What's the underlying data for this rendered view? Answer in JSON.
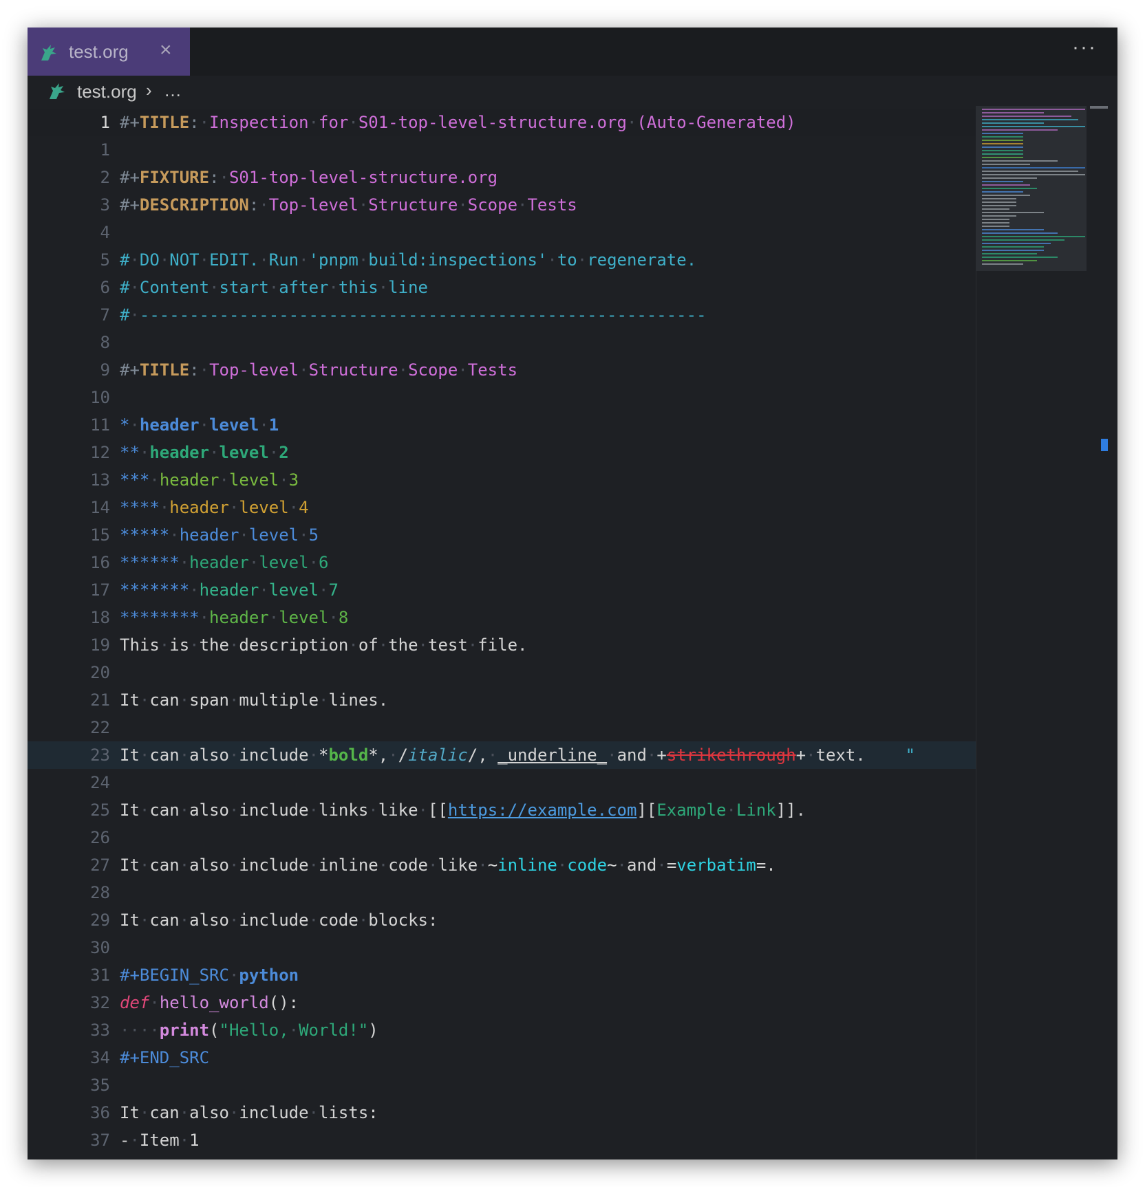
{
  "tab": {
    "label": "test.org",
    "close_glyph": "×",
    "icon": "unicorn-icon"
  },
  "more_glyph": "···",
  "breadcrumb": {
    "file": "test.org",
    "separator": "›",
    "more": "…"
  },
  "colors": {
    "tab_active": "#4b3c78",
    "editor_bg": "#1e2024"
  },
  "lines": [
    {
      "n": "1",
      "tokens": [
        [
          "c-meta",
          "#+"
        ],
        [
          "c-key",
          "TITLE"
        ],
        [
          "c-meta",
          ":"
        ],
        [
          "ws",
          "·"
        ],
        [
          "c-title",
          "Inspection"
        ],
        [
          "ws",
          "·"
        ],
        [
          "c-title",
          "for"
        ],
        [
          "ws",
          "·"
        ],
        [
          "c-title",
          "S01-top-level-structure.org"
        ],
        [
          "ws",
          "·"
        ],
        [
          "c-title",
          "(Auto-Generated)"
        ]
      ]
    },
    {
      "n": "1",
      "tokens": []
    },
    {
      "n": "2",
      "tokens": [
        [
          "c-meta",
          "#+"
        ],
        [
          "c-key",
          "FIXTURE"
        ],
        [
          "c-meta",
          ":"
        ],
        [
          "ws",
          "·"
        ],
        [
          "c-title",
          "S01-top-level-structure.org"
        ]
      ]
    },
    {
      "n": "3",
      "tokens": [
        [
          "c-meta",
          "#+"
        ],
        [
          "c-key",
          "DESCRIPTION"
        ],
        [
          "c-meta",
          ":"
        ],
        [
          "ws",
          "·"
        ],
        [
          "c-title",
          "Top-level"
        ],
        [
          "ws",
          "·"
        ],
        [
          "c-title",
          "Structure"
        ],
        [
          "ws",
          "·"
        ],
        [
          "c-title",
          "Scope"
        ],
        [
          "ws",
          "·"
        ],
        [
          "c-title",
          "Tests"
        ]
      ]
    },
    {
      "n": "4",
      "tokens": []
    },
    {
      "n": "5",
      "tokens": [
        [
          "c-comment",
          "#"
        ],
        [
          "ws",
          "·"
        ],
        [
          "c-comment",
          "DO"
        ],
        [
          "ws",
          "·"
        ],
        [
          "c-comment",
          "NOT"
        ],
        [
          "ws",
          "·"
        ],
        [
          "c-comment",
          "EDIT."
        ],
        [
          "ws",
          "·"
        ],
        [
          "c-comment",
          "Run"
        ],
        [
          "ws",
          "·"
        ],
        [
          "c-comment",
          "'pnpm"
        ],
        [
          "ws",
          "·"
        ],
        [
          "c-comment",
          "build:inspections'"
        ],
        [
          "ws",
          "·"
        ],
        [
          "c-comment",
          "to"
        ],
        [
          "ws",
          "·"
        ],
        [
          "c-comment",
          "regenerate."
        ]
      ]
    },
    {
      "n": "6",
      "tokens": [
        [
          "c-comment",
          "#"
        ],
        [
          "ws",
          "·"
        ],
        [
          "c-comment",
          "Content"
        ],
        [
          "ws",
          "·"
        ],
        [
          "c-comment",
          "start"
        ],
        [
          "ws",
          "·"
        ],
        [
          "c-comment",
          "after"
        ],
        [
          "ws",
          "·"
        ],
        [
          "c-comment",
          "this"
        ],
        [
          "ws",
          "·"
        ],
        [
          "c-comment",
          "line"
        ]
      ]
    },
    {
      "n": "7",
      "tokens": [
        [
          "c-comment",
          "#"
        ],
        [
          "ws",
          "·"
        ],
        [
          "c-comment",
          "---------------------------------------------------------"
        ]
      ]
    },
    {
      "n": "8",
      "tokens": []
    },
    {
      "n": "9",
      "tokens": [
        [
          "c-meta",
          "#+"
        ],
        [
          "c-key",
          "TITLE"
        ],
        [
          "c-meta",
          ":"
        ],
        [
          "ws",
          "·"
        ],
        [
          "c-title",
          "Top-level"
        ],
        [
          "ws",
          "·"
        ],
        [
          "c-title",
          "Structure"
        ],
        [
          "ws",
          "·"
        ],
        [
          "c-title",
          "Scope"
        ],
        [
          "ws",
          "·"
        ],
        [
          "c-title",
          "Tests"
        ]
      ]
    },
    {
      "n": "10",
      "tokens": []
    },
    {
      "n": "11",
      "tokens": [
        [
          "c-star",
          "*"
        ],
        [
          "ws",
          "·"
        ],
        [
          "c-h1",
          "header"
        ],
        [
          "ws",
          "·"
        ],
        [
          "c-h1",
          "level"
        ],
        [
          "ws",
          "·"
        ],
        [
          "c-h1",
          "1"
        ]
      ]
    },
    {
      "n": "12",
      "tokens": [
        [
          "c-star",
          "**"
        ],
        [
          "ws",
          "·"
        ],
        [
          "c-h2",
          "header"
        ],
        [
          "ws",
          "·"
        ],
        [
          "c-h2",
          "level"
        ],
        [
          "ws",
          "·"
        ],
        [
          "c-h2",
          "2"
        ]
      ]
    },
    {
      "n": "13",
      "tokens": [
        [
          "c-star",
          "***"
        ],
        [
          "ws",
          "·"
        ],
        [
          "c-h3",
          "header"
        ],
        [
          "ws",
          "·"
        ],
        [
          "c-h3",
          "level"
        ],
        [
          "ws",
          "·"
        ],
        [
          "c-h3",
          "3"
        ]
      ]
    },
    {
      "n": "14",
      "tokens": [
        [
          "c-star",
          "****"
        ],
        [
          "ws",
          "·"
        ],
        [
          "c-h4",
          "header"
        ],
        [
          "ws",
          "·"
        ],
        [
          "c-h4",
          "level"
        ],
        [
          "ws",
          "·"
        ],
        [
          "c-h4",
          "4"
        ]
      ]
    },
    {
      "n": "15",
      "tokens": [
        [
          "c-star",
          "*****"
        ],
        [
          "ws",
          "·"
        ],
        [
          "c-h5",
          "header"
        ],
        [
          "ws",
          "·"
        ],
        [
          "c-h5",
          "level"
        ],
        [
          "ws",
          "·"
        ],
        [
          "c-h5",
          "5"
        ]
      ]
    },
    {
      "n": "16",
      "tokens": [
        [
          "c-star",
          "******"
        ],
        [
          "ws",
          "·"
        ],
        [
          "c-h6",
          "header"
        ],
        [
          "ws",
          "·"
        ],
        [
          "c-h6",
          "level"
        ],
        [
          "ws",
          "·"
        ],
        [
          "c-h6",
          "6"
        ]
      ]
    },
    {
      "n": "17",
      "tokens": [
        [
          "c-star",
          "*******"
        ],
        [
          "ws",
          "·"
        ],
        [
          "c-h7",
          "header"
        ],
        [
          "ws",
          "·"
        ],
        [
          "c-h7",
          "level"
        ],
        [
          "ws",
          "·"
        ],
        [
          "c-h7",
          "7"
        ]
      ]
    },
    {
      "n": "18",
      "tokens": [
        [
          "c-star",
          "********"
        ],
        [
          "ws",
          "·"
        ],
        [
          "c-h8",
          "header"
        ],
        [
          "ws",
          "·"
        ],
        [
          "c-h8",
          "level"
        ],
        [
          "ws",
          "·"
        ],
        [
          "c-h8",
          "8"
        ]
      ]
    },
    {
      "n": "19",
      "tokens": [
        [
          "",
          "This"
        ],
        [
          "ws",
          "·"
        ],
        [
          "",
          "is"
        ],
        [
          "ws",
          "·"
        ],
        [
          "",
          "the"
        ],
        [
          "ws",
          "·"
        ],
        [
          "",
          "description"
        ],
        [
          "ws",
          "·"
        ],
        [
          "",
          "of"
        ],
        [
          "ws",
          "·"
        ],
        [
          "",
          "the"
        ],
        [
          "ws",
          "·"
        ],
        [
          "",
          "test"
        ],
        [
          "ws",
          "·"
        ],
        [
          "",
          "file."
        ]
      ]
    },
    {
      "n": "20",
      "tokens": []
    },
    {
      "n": "21",
      "tokens": [
        [
          "",
          "It"
        ],
        [
          "ws",
          "·"
        ],
        [
          "",
          "can"
        ],
        [
          "ws",
          "·"
        ],
        [
          "",
          "span"
        ],
        [
          "ws",
          "·"
        ],
        [
          "",
          "multiple"
        ],
        [
          "ws",
          "·"
        ],
        [
          "",
          "lines."
        ]
      ]
    },
    {
      "n": "22",
      "tokens": []
    },
    {
      "n": "23",
      "tokens": [
        [
          "",
          "It"
        ],
        [
          "ws",
          "·"
        ],
        [
          "",
          "can"
        ],
        [
          "ws",
          "·"
        ],
        [
          "",
          "also"
        ],
        [
          "ws",
          "·"
        ],
        [
          "",
          "include"
        ],
        [
          "ws",
          "·"
        ],
        [
          "",
          "*"
        ],
        [
          "c-bold",
          "bold"
        ],
        [
          "",
          "*,"
        ],
        [
          "ws",
          "·"
        ],
        [
          "",
          "/"
        ],
        [
          "c-italic",
          "italic"
        ],
        [
          "",
          "/,"
        ],
        [
          "ws",
          "·"
        ],
        [
          "c-under",
          "_underline_"
        ],
        [
          "ws",
          "·"
        ],
        [
          "",
          "and"
        ],
        [
          "ws",
          "·"
        ],
        [
          "",
          "+"
        ],
        [
          "c-strike",
          "strikethrough"
        ],
        [
          "",
          "+"
        ],
        [
          "ws",
          "·"
        ],
        [
          "",
          "text."
        ],
        [
          "",
          "    "
        ],
        [
          "c-comment",
          "\""
        ]
      ]
    },
    {
      "n": "24",
      "tokens": []
    },
    {
      "n": "25",
      "tokens": [
        [
          "",
          "It"
        ],
        [
          "ws",
          "·"
        ],
        [
          "",
          "can"
        ],
        [
          "ws",
          "·"
        ],
        [
          "",
          "also"
        ],
        [
          "ws",
          "·"
        ],
        [
          "",
          "include"
        ],
        [
          "ws",
          "·"
        ],
        [
          "",
          "links"
        ],
        [
          "ws",
          "·"
        ],
        [
          "",
          "like"
        ],
        [
          "ws",
          "·"
        ],
        [
          "",
          "[["
        ],
        [
          "c-link",
          "https://example.com"
        ],
        [
          "",
          "]["
        ],
        [
          "c-desc",
          "Example"
        ],
        [
          "ws",
          "·"
        ],
        [
          "c-desc",
          "Link"
        ],
        [
          "",
          "]]."
        ]
      ]
    },
    {
      "n": "26",
      "tokens": []
    },
    {
      "n": "27",
      "tokens": [
        [
          "",
          "It"
        ],
        [
          "ws",
          "·"
        ],
        [
          "",
          "can"
        ],
        [
          "ws",
          "·"
        ],
        [
          "",
          "also"
        ],
        [
          "ws",
          "·"
        ],
        [
          "",
          "include"
        ],
        [
          "ws",
          "·"
        ],
        [
          "",
          "inline"
        ],
        [
          "ws",
          "·"
        ],
        [
          "",
          "code"
        ],
        [
          "ws",
          "·"
        ],
        [
          "",
          "like"
        ],
        [
          "ws",
          "·"
        ],
        [
          "",
          "~"
        ],
        [
          "c-code",
          "inline"
        ],
        [
          "ws",
          "·"
        ],
        [
          "c-code",
          "code"
        ],
        [
          "",
          "~"
        ],
        [
          "ws",
          "·"
        ],
        [
          "",
          "and"
        ],
        [
          "ws",
          "·"
        ],
        [
          "",
          "="
        ],
        [
          "c-code",
          "verbatim"
        ],
        [
          "",
          "=."
        ]
      ]
    },
    {
      "n": "28",
      "tokens": []
    },
    {
      "n": "29",
      "tokens": [
        [
          "",
          "It"
        ],
        [
          "ws",
          "·"
        ],
        [
          "",
          "can"
        ],
        [
          "ws",
          "·"
        ],
        [
          "",
          "also"
        ],
        [
          "ws",
          "·"
        ],
        [
          "",
          "include"
        ],
        [
          "ws",
          "·"
        ],
        [
          "",
          "code"
        ],
        [
          "ws",
          "·"
        ],
        [
          "",
          "blocks:"
        ]
      ]
    },
    {
      "n": "30",
      "tokens": []
    },
    {
      "n": "31",
      "tokens": [
        [
          "c-src",
          "#+BEGIN_SRC"
        ],
        [
          "ws",
          "·"
        ],
        [
          "c-lang",
          "python"
        ]
      ]
    },
    {
      "n": "32",
      "tokens": [
        [
          "c-def",
          "def"
        ],
        [
          "ws",
          "·"
        ],
        [
          "c-fn",
          "hello_world"
        ],
        [
          "",
          "():"
        ]
      ]
    },
    {
      "n": "33",
      "tokens": [
        [
          "ws",
          "····"
        ],
        [
          "c-print",
          "print"
        ],
        [
          "",
          "("
        ],
        [
          "c-str",
          "\"Hello,"
        ],
        [
          "ws",
          "·"
        ],
        [
          "c-str",
          "World!\""
        ],
        [
          "",
          ")"
        ]
      ]
    },
    {
      "n": "34",
      "tokens": [
        [
          "c-src",
          "#+END_SRC"
        ]
      ]
    },
    {
      "n": "35",
      "tokens": []
    },
    {
      "n": "36",
      "tokens": [
        [
          "",
          "It"
        ],
        [
          "ws",
          "·"
        ],
        [
          "",
          "can"
        ],
        [
          "ws",
          "·"
        ],
        [
          "",
          "also"
        ],
        [
          "ws",
          "·"
        ],
        [
          "",
          "include"
        ],
        [
          "ws",
          "·"
        ],
        [
          "",
          "lists:"
        ]
      ]
    },
    {
      "n": "37",
      "tokens": [
        [
          "",
          "-"
        ],
        [
          "ws",
          "·"
        ],
        [
          "",
          "Item"
        ],
        [
          "ws",
          "·"
        ],
        [
          "",
          "1"
        ]
      ]
    }
  ]
}
